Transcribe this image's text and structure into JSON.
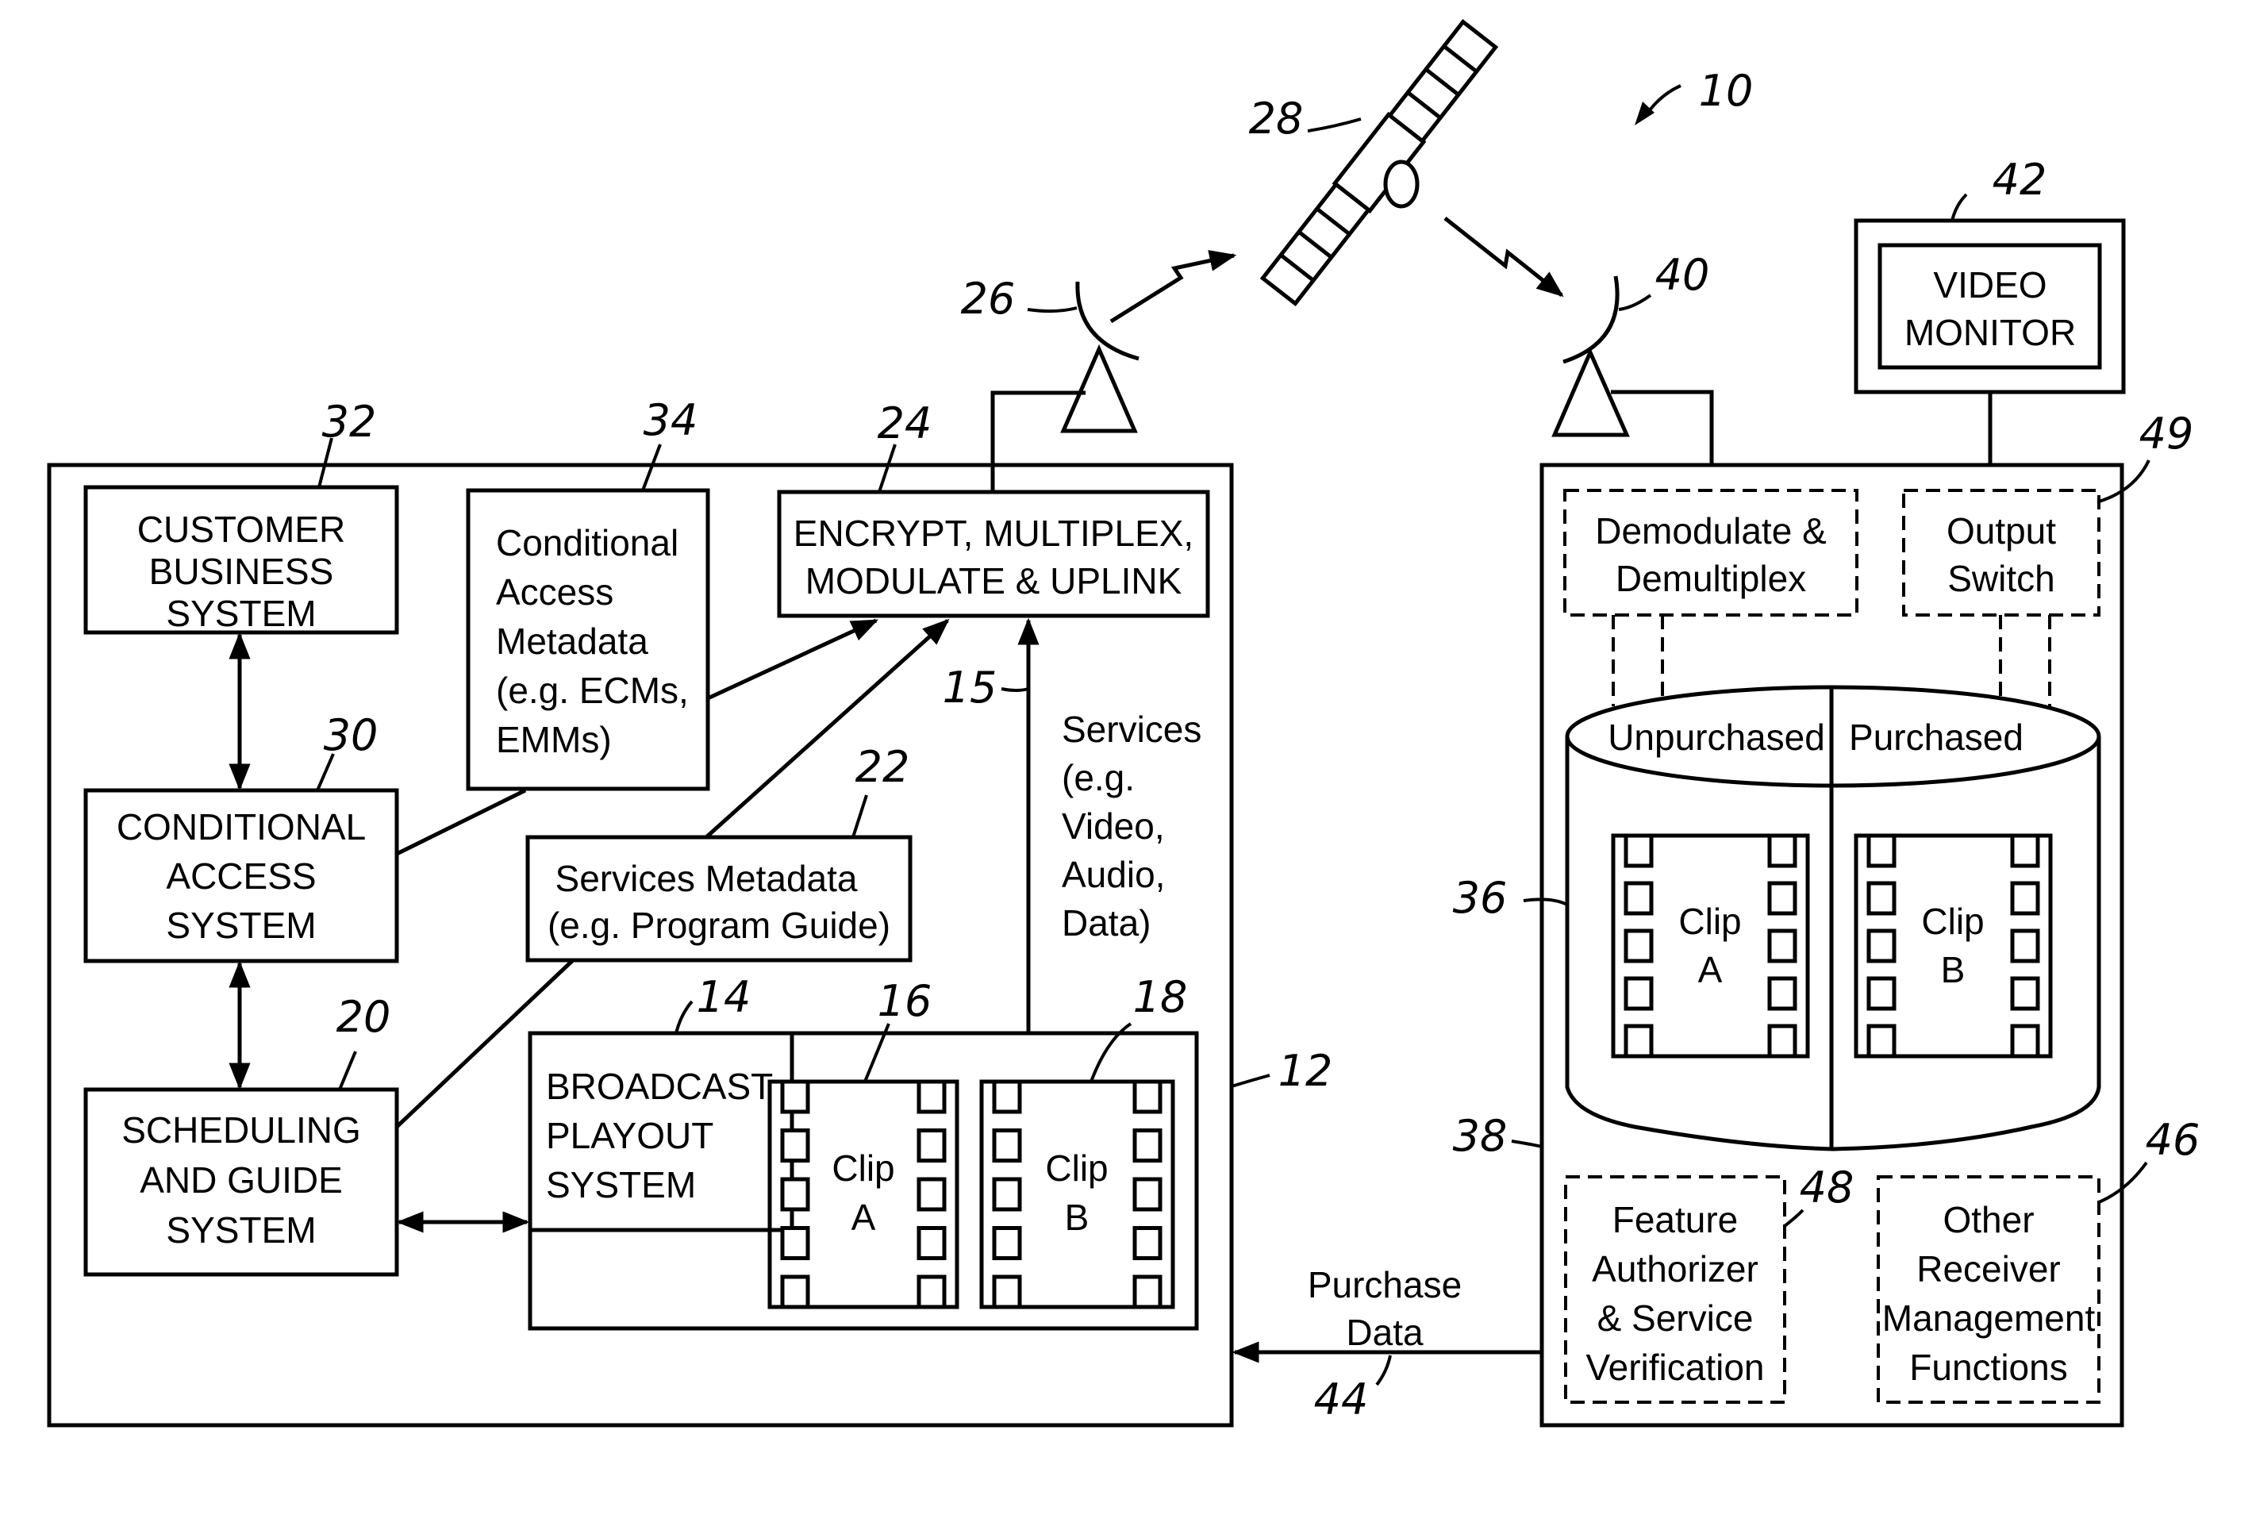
{
  "figure": {
    "system_ref": "10",
    "headend": {
      "ref": "12",
      "customer_business": {
        "ref": "32",
        "lines": [
          "CUSTOMER",
          "BUSINESS",
          "SYSTEM"
        ]
      },
      "ca_metadata": {
        "ref": "34",
        "lines": [
          "Conditional",
          "Access",
          "Metadata",
          "(e.g. ECMs,",
          "EMMs)"
        ]
      },
      "encrypt": {
        "ref": "24",
        "lines": [
          "ENCRYPT, MULTIPLEX,",
          "MODULATE & UPLINK"
        ]
      },
      "ca_system": {
        "ref": "30",
        "lines": [
          "CONDITIONAL",
          "ACCESS",
          "SYSTEM"
        ]
      },
      "services_metadata": {
        "ref": "22",
        "lines": [
          "Services Metadata",
          "(e.g. Program Guide)"
        ]
      },
      "scheduling": {
        "ref": "20",
        "lines": [
          "SCHEDULING",
          "AND GUIDE",
          "SYSTEM"
        ]
      },
      "broadcast": {
        "ref": "14",
        "lines": [
          "BROADCAST",
          "PLAYOUT",
          "SYSTEM"
        ]
      },
      "clip_a": {
        "ref": "16",
        "lines": [
          "Clip",
          "A"
        ]
      },
      "clip_b": {
        "ref": "18",
        "lines": [
          "Clip",
          "B"
        ]
      },
      "services_path": {
        "ref": "15",
        "lines": [
          "Services",
          "(e.g.",
          "Video,",
          "Audio,",
          "Data)"
        ]
      }
    },
    "uplink_antenna_ref": "26",
    "satellite_ref": "28",
    "downlink_antenna_ref": "40",
    "receiver": {
      "ref": "38",
      "demod": {
        "lines": [
          "Demodulate &",
          "Demultiplex"
        ]
      },
      "output_switch": {
        "ref": "49",
        "lines": [
          "Output",
          "Switch"
        ]
      },
      "storage": {
        "ref": "36",
        "left_label": "Unpurchased",
        "right_label": "Purchased"
      },
      "clip_a": {
        "lines": [
          "Clip",
          "A"
        ]
      },
      "clip_b": {
        "lines": [
          "Clip",
          "B"
        ]
      },
      "feature_auth": {
        "ref": "48",
        "lines": [
          "Feature",
          "Authorizer",
          "& Service",
          "Verification"
        ]
      },
      "other_mgmt": {
        "ref": "46",
        "lines": [
          "Other",
          "Receiver",
          "Management",
          "Functions"
        ]
      }
    },
    "video_monitor": {
      "ref": "42",
      "lines": [
        "VIDEO",
        "MONITOR"
      ]
    },
    "purchase_data": {
      "ref": "44",
      "lines": [
        "Purchase",
        "Data"
      ]
    }
  }
}
